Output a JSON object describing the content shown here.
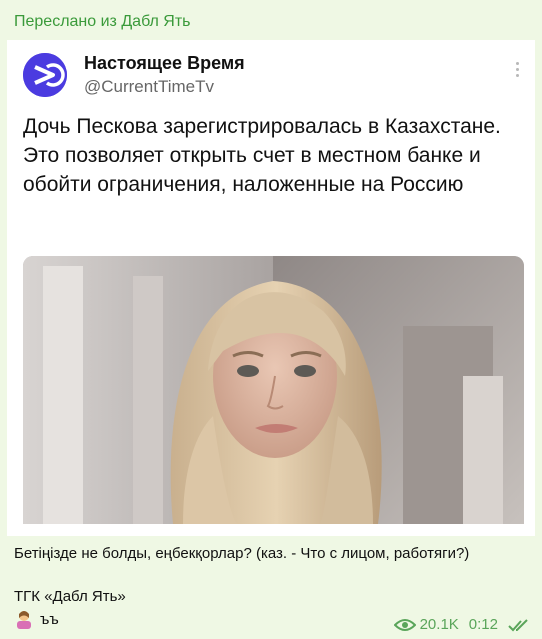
{
  "forward_header": "Переслано из Дабл Ять",
  "tweet": {
    "account_name": "Настоящее Время",
    "handle": "@CurrentTimeTv",
    "text": "Дочь Пескова зарегистрировалась в Казахстане. Это позволяет открыть счет в местном банке и обойти ограничения, наложенные на Россию",
    "logo_icon": "current-time-logo",
    "menu_icon": "vertical-dots-icon"
  },
  "caption": "Бетіңізде не болды, еңбекқорлар? (каз. - Что с лицом, работяги?)",
  "source": "ТГК «Дабл Ять»",
  "emoji_text": "ъъ",
  "meta": {
    "views": "20.1K",
    "time": "0:12",
    "accent_color": "#5aa55a"
  }
}
